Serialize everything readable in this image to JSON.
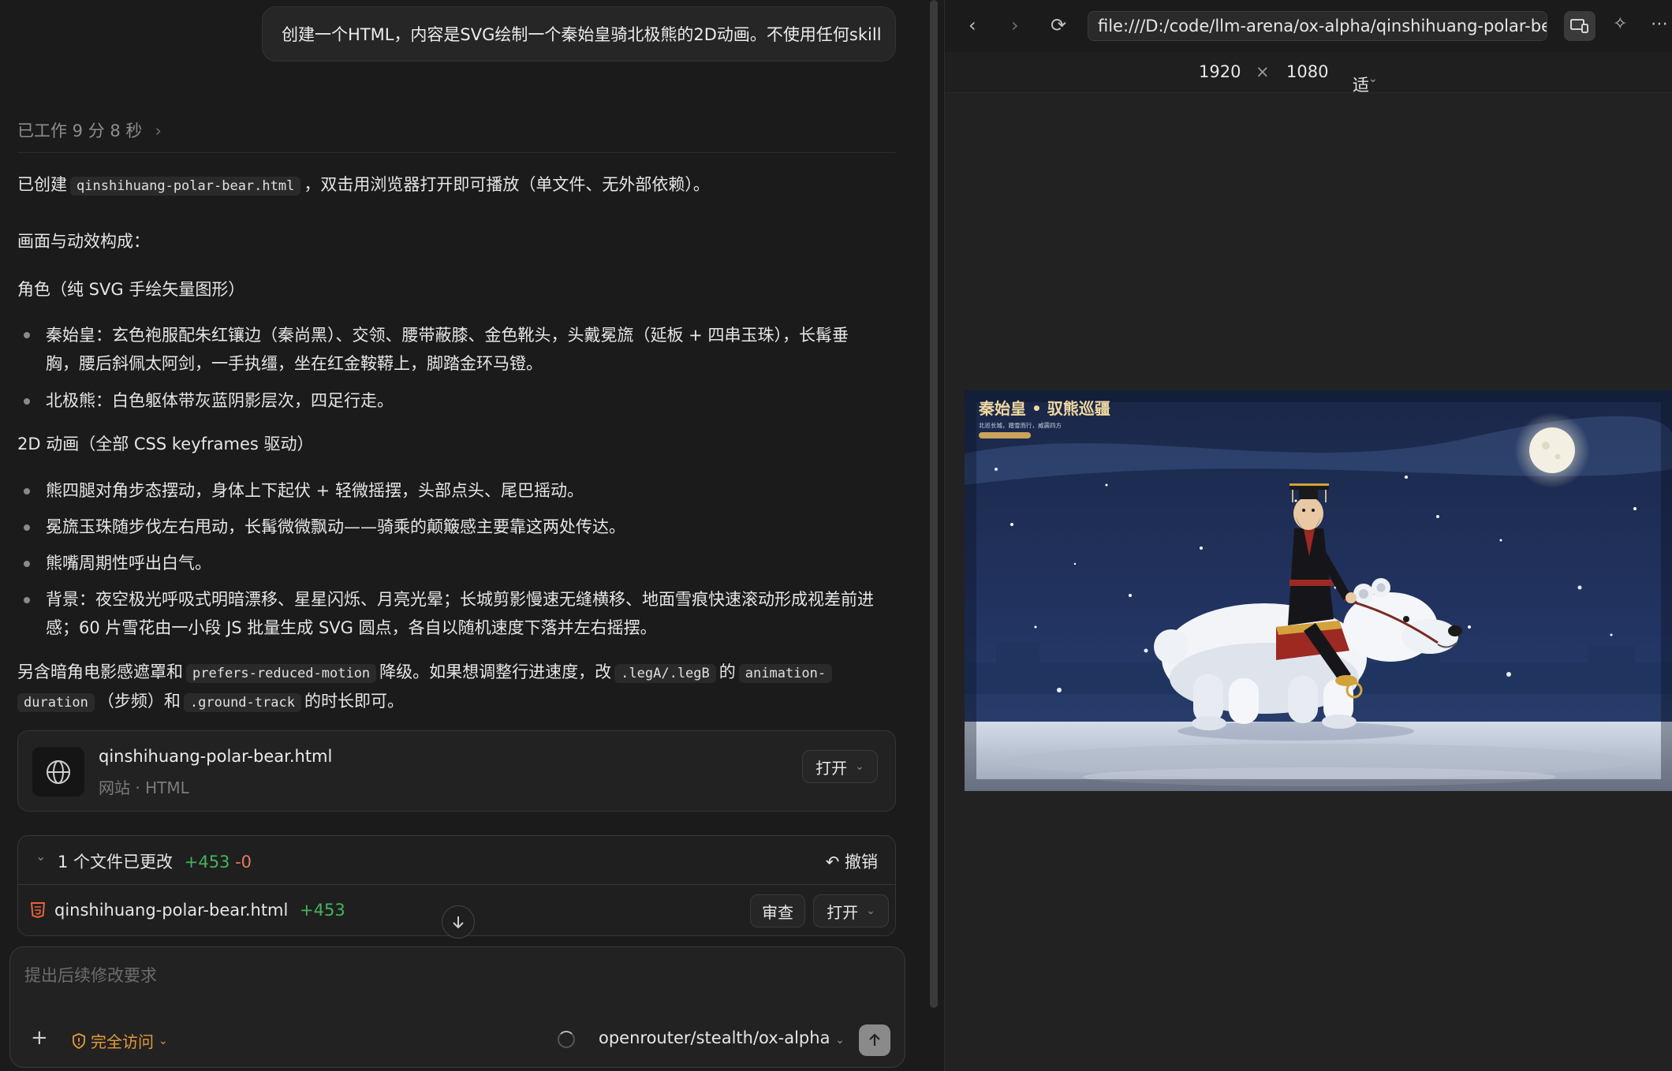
{
  "chat": {
    "user_message": "创建一个HTML，内容是SVG绘制一个秦始皇骑北极熊的2D动画。不使用任何skill",
    "worked_label": "已工作 9 分 8 秒",
    "p1_prefix": "已创建",
    "p1_file": "qinshihuang-polar-bear.html",
    "p1_suffix": "，双击用浏览器打开即可播放（单文件、无外部依赖）。",
    "p2": "画面与动效构成：",
    "p3": "角色（纯 SVG 手绘矢量图形）",
    "li1_line1": "秦始皇：玄色袍服配朱红镶边（秦尚黑）、交领、腰带蔽膝、金色靴头，头戴冕旒（延板 + 四串玉珠），长髯垂",
    "li1_line2": "胸，腰后斜佩太阿剑，一手执缰，坐在红金鞍鞯上，脚踏金环马镫。",
    "li2": "北极熊：白色躯体带灰蓝阴影层次，四足行走。",
    "p4": "2D 动画（全部 CSS keyframes 驱动）",
    "li3": "熊四腿对角步态摆动，身体上下起伏 + 轻微摇摆，头部点头、尾巴摇动。",
    "li4": "冕旒玉珠随步伐左右甩动，长髯微微飘动——骑乘的颠簸感主要靠这两处传达。",
    "li5": "熊嘴周期性呼出白气。",
    "li6_line1": "背景：夜空极光呼吸式明暗漂移、星星闪烁、月亮光晕；长城剪影慢速无缝横移、地面雪痕快速滚动形成视差前进",
    "li6_line2": "感；60 片雪花由一小段 JS 批量生成 SVG 圆点，各自以随机速度下落并左右摇摆。",
    "p5_a": "另含暗角电影感遮罩和",
    "p5_code1": "prefers-reduced-motion",
    "p5_b": "降级。如果想调整行进速度，改",
    "p5_code2": ".legA/.legB",
    "p5_c": "的",
    "p5_code3": "animation-",
    "p5_code3b": "duration",
    "p5_d": "（步频）和",
    "p5_code4": ".ground-track",
    "p5_e": "的时长即可。"
  },
  "file_card": {
    "name": "qinshihuang-polar-bear.html",
    "sub": "网站 · HTML",
    "open_label": "打开"
  },
  "changes": {
    "title": "1 个文件已更改",
    "added": "+453",
    "removed": "-0",
    "undo_label": "撤销",
    "file_name": "qinshihuang-polar-bear.html",
    "file_added": "+453",
    "review_label": "审查",
    "open_label": "打开"
  },
  "composer": {
    "placeholder": "提出后续修改要求",
    "access_label": "完全访问",
    "model": "openrouter/stealth/ox-alpha"
  },
  "browser": {
    "url": "file:///D:/code/llm-arena/ox-alpha/qinshihuang-polar-bear.html",
    "width": "1920",
    "times": "×",
    "height": "1080",
    "fit_label": "适应窗口",
    "scene_title": "秦始皇 • 驭熊巡疆",
    "scene_subtitle": "北巡长城，踏雪而行，威震四方"
  },
  "colors": {
    "accent_green": "#46b35a",
    "accent_orange": "#e49a3a",
    "panel_bg": "#1b1b1b"
  }
}
